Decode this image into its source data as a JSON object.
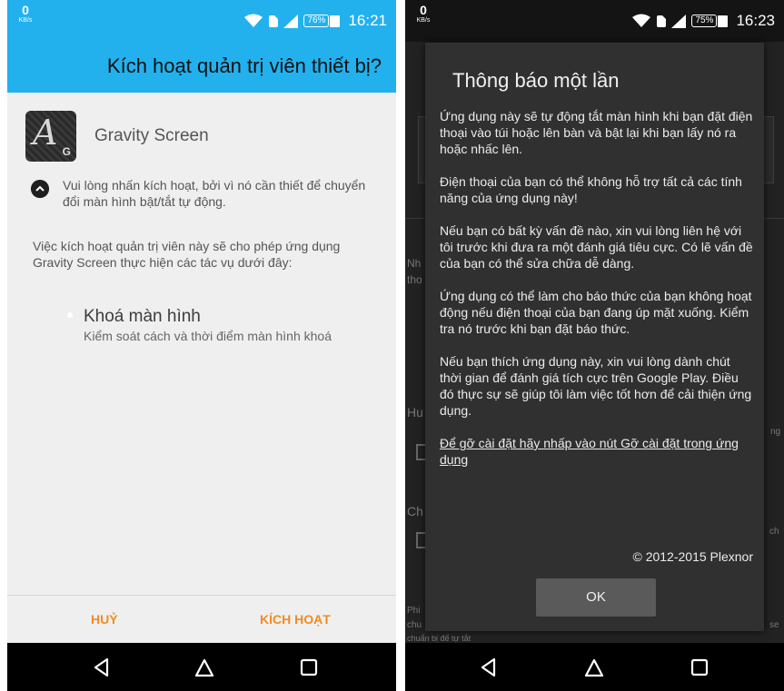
{
  "left_screen": {
    "status": {
      "net_speed": "0",
      "net_unit": "KB/s",
      "battery": "76%",
      "time": "16:21"
    },
    "app_bar": {
      "title": "Kích hoạt quản trị viên thiết bị?"
    },
    "app": {
      "name": "Gravity Screen",
      "icon_main": "A",
      "icon_sub": "G"
    },
    "notice": "Vui lòng nhấn kích hoạt, bởi vì nó cần thiết để chuyển đổi màn hình bật/tắt tự động.",
    "description": "Việc kích hoạt quản trị viên này sẽ cho phép ứng dụng Gravity Screen thực hiện các tác vụ dưới đây:",
    "permission": {
      "title": "Khoá màn hình",
      "desc": "Kiểm soát cách và thời điểm màn hình khoá"
    },
    "buttons": {
      "cancel": "HUỶ",
      "activate": "KÍCH HOẠT"
    }
  },
  "right_screen": {
    "status": {
      "net_speed": "0",
      "net_unit": "KB/s",
      "battery": "75%",
      "time": "16:23"
    },
    "dialog": {
      "title": "Thông báo một lần",
      "paragraphs": [
        "Ứng dụng này sẽ tự động tắt màn hình khi bạn đặt điện thoại vào túi hoặc lên bàn và bật lại khi bạn lấy nó ra hoặc nhấc lên.",
        "Điện thoại của bạn có thể không hỗ trợ tất cả các tính năng của ứng dụng này!",
        "Nếu bạn có bất kỳ vấn đề nào, xin vui lòng liên hệ với tôi trước khi đưa ra một đánh giá tiêu cực. Có lẽ vấn đề của bạn có thể sửa chữa dễ dàng.",
        "Ứng dụng có thể làm cho báo thức của bạn không hoạt động nếu điện thoại của bạn đang úp mặt xuống. Kiểm tra nó trước khi bạn đặt báo thức.",
        "Nếu bạn thích ứng dụng này, xin vui lòng dành chút thời gian để đánh giá tích cực trên Google Play. Điều đó thực sự sẽ giúp tôi làm việc tốt hơn để cải thiện ứng dụng."
      ],
      "link": "Để gỡ cài đặt hãy nhấp vào nút Gỡ cài đặt trong ứng dụng",
      "copyright": "© 2012-2015 Plexnor",
      "ok": "OK"
    },
    "background": {
      "t1": "Nh",
      "t2": "tho",
      "t3": "Hu",
      "t4": "Ch",
      "t5": "Phi",
      "t6": "chu",
      "t7": "chuẩn bị để tự tắt",
      "t8": "ch",
      "t9": "se",
      "t10": "ng"
    }
  },
  "colors": {
    "accent": "#23b1ee",
    "button_text": "#f08c21",
    "dialog_bg": "#303030"
  },
  "icons": [
    "wifi-icon",
    "sim-icon",
    "signal-icon",
    "battery-icon",
    "back-icon",
    "home-icon",
    "recents-icon",
    "chevron-down-icon"
  ]
}
